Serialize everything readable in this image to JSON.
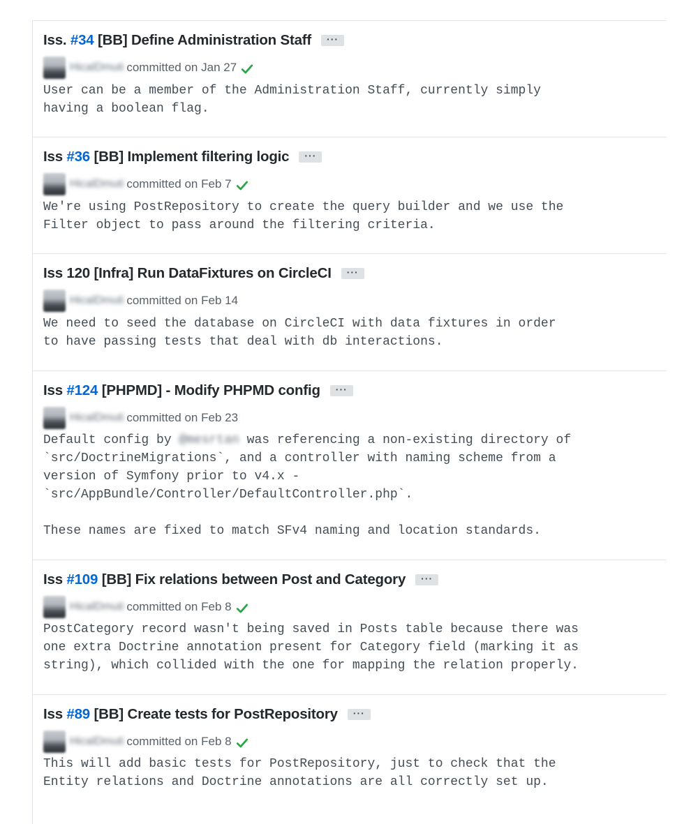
{
  "commits": [
    {
      "title_prefix": "Iss. ",
      "issue": "#34",
      "title_rest": " [BB] Define Administration Staff",
      "author": "HicalDmuti",
      "committed": "committed on Jan 27",
      "verified": true,
      "body_lines": [
        "User can be a member of the Administration Staff, currently simply",
        "having a boolean flag."
      ]
    },
    {
      "title_prefix": "Iss ",
      "issue": "#36",
      "title_rest": " [BB] Implement filtering logic",
      "author": "HicalDmuti",
      "committed": "committed on Feb 7",
      "verified": true,
      "body_lines": [
        "We're using PostRepository to create the query builder and we use the",
        "Filter object to pass around the filtering criteria."
      ]
    },
    {
      "title_prefix": "Iss 120 [Infra] Run DataFixtures on CircleCI",
      "issue": "",
      "title_rest": "",
      "author": "HicalDmuti",
      "committed": "committed on Feb 14",
      "verified": false,
      "body_lines": [
        "We need to seed the database on CircleCI with data fixtures in order",
        "to have passing tests that deal with db interactions."
      ]
    },
    {
      "title_prefix": "Iss ",
      "issue": "#124",
      "title_rest": " [PHPMD] - Modify PHPMD config",
      "author": "HicalDmuti",
      "committed": "committed on Feb 23",
      "verified": false,
      "body_line1_pre": "Default config by ",
      "body_line1_mention": "@mesrtan",
      "body_line1_post": " was referencing a non-existing directory of",
      "body_lines": [
        "`src/DoctrineMigrations`, and a controller with naming scheme from a",
        "version of Symfony prior to v4.x -",
        "`src/AppBundle/Controller/DefaultController.php`.",
        "",
        "These names are fixed to match SFv4 naming and location standards."
      ]
    },
    {
      "title_prefix": "Iss ",
      "issue": "#109",
      "title_rest": " [BB] Fix relations between Post and Category",
      "author": "HicalDmuti",
      "committed": "committed on Feb 8",
      "verified": true,
      "body_lines": [
        "PostCategory record wasn't being saved in Posts table because there was",
        "one extra Doctrine annotation present for Category field (marking it as",
        "string), which collided with the one for mapping the relation properly."
      ]
    },
    {
      "title_prefix": "Iss ",
      "issue": "#89",
      "title_rest": " [BB] Create tests for PostRepository",
      "author": "HicalDmuti",
      "committed": "committed on Feb 8",
      "verified": true,
      "body_lines": [
        "This will add basic tests for PostRepository, just to check that the",
        "Entity relations and Doctrine annotations are all correctly set up."
      ]
    }
  ],
  "ellipsis_label": "···",
  "colors": {
    "link": "#0366d6",
    "check": "#28a745",
    "border": "#e1e4e8"
  }
}
